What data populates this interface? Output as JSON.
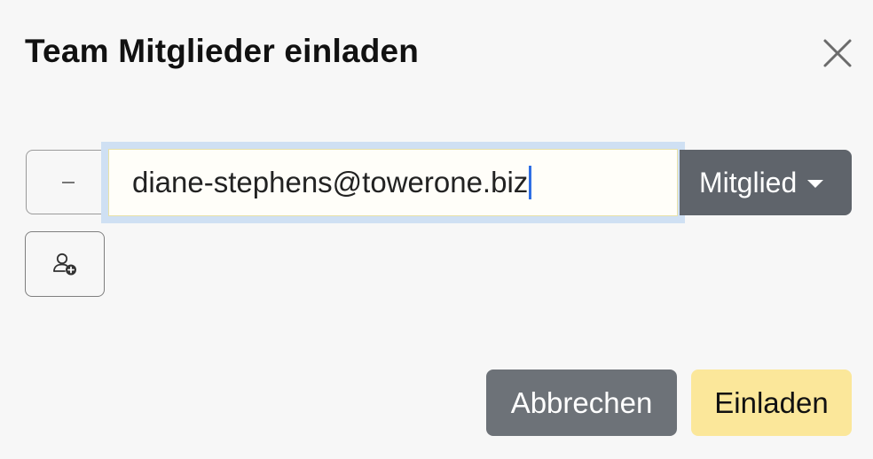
{
  "dialog": {
    "title": "Team Mitglieder einladen",
    "close_icon": "close-icon"
  },
  "invite_row": {
    "remove_icon": "minus-icon",
    "email_value": "diane-stephens@towerone.biz",
    "role": {
      "selected": "Mitglied",
      "icon": "caret-down-icon"
    }
  },
  "add_member": {
    "icon": "add-user-icon"
  },
  "footer": {
    "cancel_label": "Abbrechen",
    "invite_label": "Einladen"
  },
  "colors": {
    "background": "#f7f7f7",
    "focus_ring": "#cfe0f3",
    "input_border": "#e8e2a8",
    "caret": "#2f6fe4",
    "dropdown_bg": "#5f646b",
    "cancel_bg": "#6d7278",
    "invite_bg": "#fbe79a"
  }
}
